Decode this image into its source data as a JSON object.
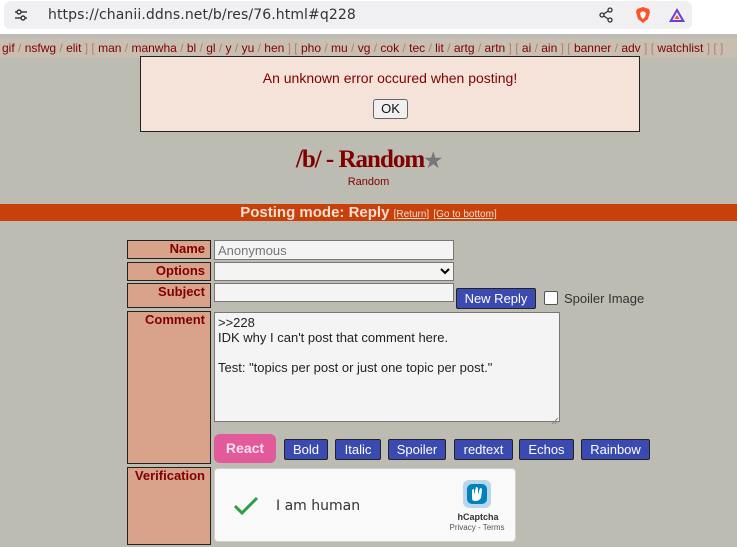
{
  "browser": {
    "url": "https://chanii.ddns.net/b/res/76.html#q228",
    "icons": [
      "site-settings-icon",
      "share-icon",
      "brave-shields-icon",
      "brave-rewards-icon"
    ]
  },
  "boardlist": {
    "groups": [
      [
        "gif",
        "nsfwg",
        "elit"
      ],
      [
        "man",
        "manwha",
        "bl",
        "gl",
        "y",
        "yu",
        "hen"
      ],
      [
        "pho",
        "mu",
        "vg",
        "cok",
        "tec",
        "lit",
        "artg",
        "artn"
      ],
      [
        "ai",
        "ain"
      ],
      [
        "banner",
        "adv"
      ],
      [
        "watchlist"
      ]
    ]
  },
  "dialog": {
    "message": "An unknown error occured when posting!",
    "ok_label": "OK"
  },
  "board": {
    "title": "/b/ - Random",
    "star": "★",
    "subtitle": "Random"
  },
  "mode": {
    "text": "Posting mode: Reply",
    "return_label": "[Return]",
    "bottom_label": "[Go to bottom]"
  },
  "form": {
    "name_label": "Name",
    "name_placeholder": "Anonymous",
    "options_label": "Options",
    "subject_label": "Subject",
    "new_reply_label": "New Reply",
    "spoiler_label": "Spoiler Image",
    "comment_label": "Comment",
    "comment_value": ">>228\nIDK why I can't post that comment here.\n\nTest: \"topics per post or just one topic per post.\"",
    "react_label": "React",
    "format_buttons": [
      "Bold",
      "Italic",
      "Spoiler",
      "redtext",
      "Echos",
      "Rainbow"
    ],
    "verification_label": "Verification"
  },
  "captcha": {
    "text": "I am human",
    "brand": "hCaptcha",
    "links": "Privacy - Terms"
  },
  "colors": {
    "background": "#bcbcb2",
    "label_bg": "#d9a28a",
    "mode_bar": "#c8410b",
    "button_blue": "#3a4ab0",
    "react_pink": "#e25a9a",
    "text_maroon": "#800000"
  }
}
